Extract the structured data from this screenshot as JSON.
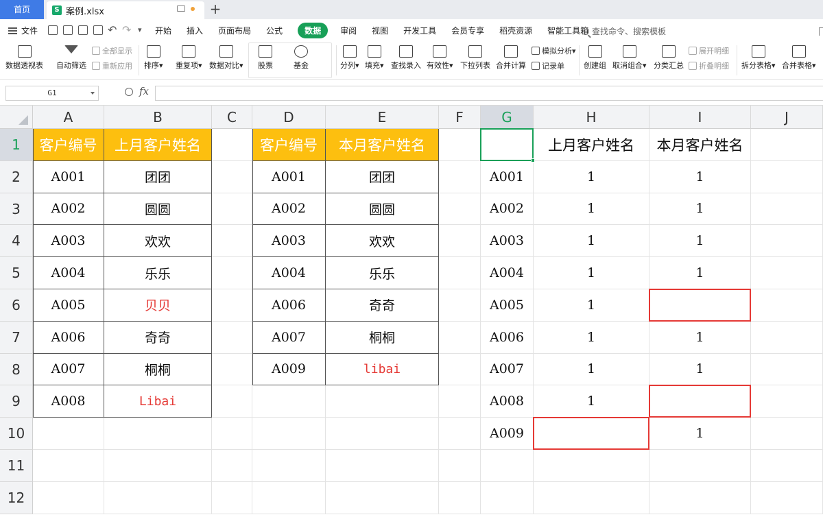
{
  "tabs": {
    "home": "首页",
    "file": "案例.xlsx",
    "file_icon": "S"
  },
  "menu": {
    "file": "文件",
    "items": [
      "开始",
      "插入",
      "页面布局",
      "公式",
      "数据",
      "审阅",
      "视图",
      "开发工具",
      "会员专享",
      "稻壳资源",
      "智能工具箱"
    ],
    "active": "数据",
    "search": "查找命令、搜索模板"
  },
  "ribbon": {
    "pivot": "数据透视表",
    "autofilter": "自动筛选",
    "show_all": "全部显示",
    "reapply": "重新应用",
    "sort": "排序",
    "duplicates": "重复项",
    "compare": "数据对比",
    "stock": "股票",
    "fund": "基金",
    "split": "分列",
    "fill": "填充",
    "lookup": "查找录入",
    "validity": "有效性",
    "dropdown": "下拉列表",
    "merge_calc": "合并计算",
    "simulate": "模拟分析",
    "record": "记录单",
    "group": "创建组",
    "ungroup": "取消组合",
    "subtotal": "分类汇总",
    "expand": "展开明细",
    "collapse": "折叠明细",
    "split_table": "拆分表格",
    "merge_table": "合并表格"
  },
  "formula": {
    "name_box": "G1",
    "fx": "fx",
    "value": ""
  },
  "columns": [
    "A",
    "B",
    "C",
    "D",
    "E",
    "F",
    "G",
    "H",
    "I",
    "J"
  ],
  "rows": [
    "1",
    "2",
    "3",
    "4",
    "5",
    "6",
    "7",
    "8",
    "9",
    "10",
    "11",
    "12"
  ],
  "selected": {
    "column": "G",
    "row": "1"
  },
  "table_last_month": {
    "headers": [
      "客户编号",
      "上月客户姓名"
    ],
    "rows": [
      [
        "A001",
        "团团"
      ],
      [
        "A002",
        "圆圆"
      ],
      [
        "A003",
        "欢欢"
      ],
      [
        "A004",
        "乐乐"
      ],
      [
        "A005",
        "贝贝"
      ],
      [
        "A006",
        "奇奇"
      ],
      [
        "A007",
        "桐桐"
      ],
      [
        "A008",
        "Libai"
      ]
    ]
  },
  "table_this_month": {
    "headers": [
      "客户编号",
      "本月客户姓名"
    ],
    "rows": [
      [
        "A001",
        "团团"
      ],
      [
        "A002",
        "圆圆"
      ],
      [
        "A003",
        "欢欢"
      ],
      [
        "A004",
        "乐乐"
      ],
      [
        "A006",
        "奇奇"
      ],
      [
        "A007",
        "桐桐"
      ],
      [
        "A009",
        "libai"
      ]
    ]
  },
  "pivot_result": {
    "headers": [
      "",
      "上月客户姓名",
      "本月客户姓名"
    ],
    "rows": [
      [
        "A001",
        "1",
        "1"
      ],
      [
        "A002",
        "1",
        "1"
      ],
      [
        "A003",
        "1",
        "1"
      ],
      [
        "A004",
        "1",
        "1"
      ],
      [
        "A005",
        "1",
        ""
      ],
      [
        "A006",
        "1",
        "1"
      ],
      [
        "A007",
        "1",
        "1"
      ],
      [
        "A008",
        "1",
        ""
      ],
      [
        "A009",
        "",
        "1"
      ]
    ]
  },
  "colors": {
    "header_fill": "#fdbf0f",
    "accent_green": "#18a058",
    "highlight_red": "#e53935",
    "home_tab": "#3f7be6"
  }
}
